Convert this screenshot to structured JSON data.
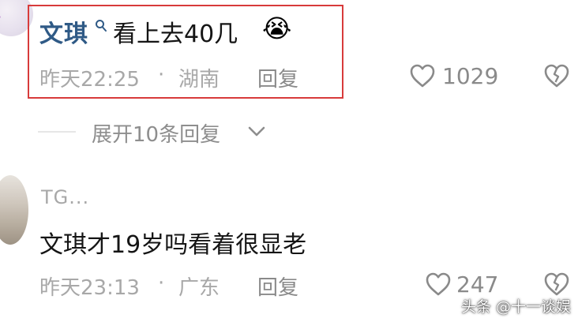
{
  "comments": [
    {
      "username": "文琪",
      "text": "看上去40几",
      "emoji": "😭",
      "time": "昨天22:25",
      "separator": "·",
      "location": "湖南",
      "reply_label": "回复",
      "likes": "1029"
    },
    {
      "username": "TG...",
      "text": "文琪才19岁吗看着很显老",
      "time": "昨天23:13",
      "separator": "·",
      "location": "广东",
      "reply_label": "回复",
      "likes": "247"
    }
  ],
  "expand_replies": "展开10条回复",
  "watermark": "头条 @十一谈娱",
  "icons": {
    "search": "magnifier-icon",
    "like": "heart-icon",
    "dislike": "broken-heart-icon",
    "expand": "chevron-down-icon"
  },
  "colors": {
    "username": "#2f5a86",
    "highlight": "#d83b3b",
    "meta": "#a8a8a8"
  }
}
